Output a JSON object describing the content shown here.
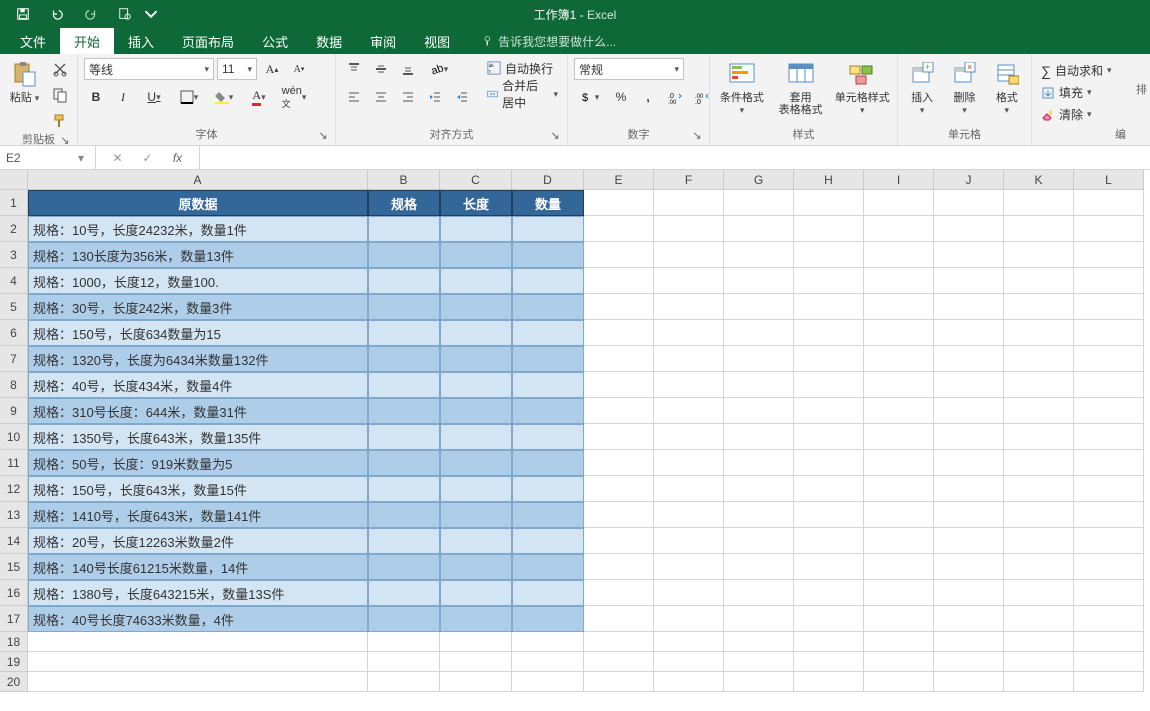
{
  "titlebar": {
    "doc": "工作簿1",
    "sep": " - ",
    "app": "Excel"
  },
  "tabs": {
    "file": "文件",
    "home": "开始",
    "insert": "插入",
    "layout": "页面布局",
    "formulas": "公式",
    "data": "数据",
    "review": "审阅",
    "view": "视图",
    "tellme": "告诉我您想要做什么..."
  },
  "ribbon": {
    "clipboard": {
      "paste": "粘贴",
      "label": "剪贴板"
    },
    "font": {
      "name": "等线",
      "size": "11",
      "label": "字体"
    },
    "align": {
      "wrap": "自动换行",
      "merge": "合并后居中",
      "label": "对齐方式"
    },
    "number": {
      "format": "常规",
      "label": "数字"
    },
    "styles": {
      "cond": "条件格式",
      "table": "套用\n表格格式",
      "cell": "单元格样式",
      "label": "样式"
    },
    "cells": {
      "insert": "插入",
      "delete": "删除",
      "format": "格式",
      "label": "单元格"
    },
    "editing": {
      "sum": "自动求和",
      "fill": "填充",
      "clear": "清除",
      "label": "编"
    }
  },
  "fbar": {
    "name": "E2",
    "formula": ""
  },
  "grid": {
    "colWidths": {
      "A": 340,
      "B": 72,
      "C": 72,
      "D": 72,
      "other": 70
    },
    "cols": [
      "A",
      "B",
      "C",
      "D",
      "E",
      "F",
      "G",
      "H",
      "I",
      "J",
      "K",
      "L"
    ],
    "rowH_header": 26,
    "rowH_data": 26,
    "rowH_empty": 20,
    "headers": {
      "A": "原数据",
      "B": "规格",
      "C": "长度",
      "D": "数量"
    },
    "rows": [
      "规格：10号，长度24232米，数量1件",
      "规格：130长度为356米，数量13件",
      "规格：1000，长度12，数量100.",
      "规格：30号，长度242米，数量3件",
      "规格：150号，长度634数量为15",
      "规格：1320号，长度为6434米数量132件",
      "规格：40号，长度434米，数量4件",
      "规格：310号长度：644米，数量31件",
      "规格：1350号，长度643米，数量135件",
      "规格：50号，长度：919米数量为5",
      "规格：150号，长度643米，数量15件",
      "规格：1410号，长度643米，数量141件",
      "规格：20号，长度12263米数量2件",
      "规格：140号长度61215米数量，14件",
      "规格：1380号，长度643215米，数量13S件",
      "规格：40号长度74633米数量，4件"
    ],
    "emptyRows": [
      18,
      19,
      20
    ]
  },
  "chart_data": null
}
